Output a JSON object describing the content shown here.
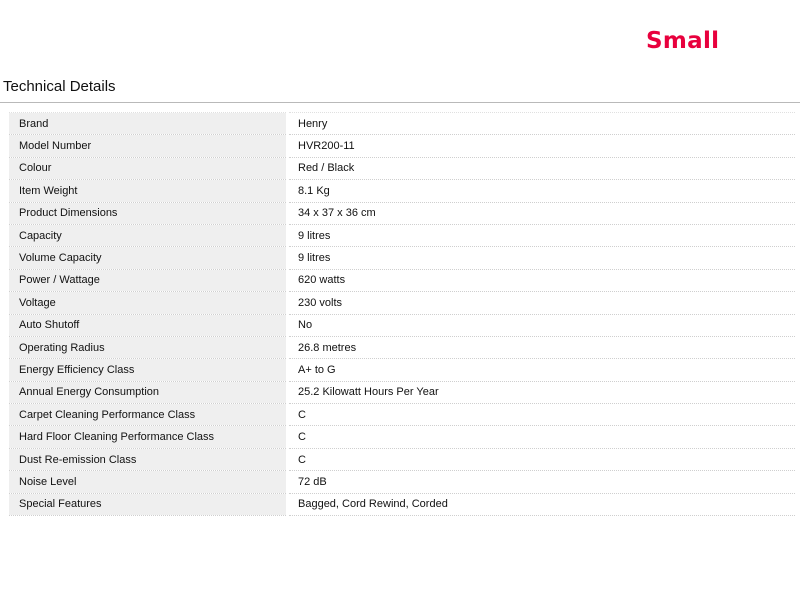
{
  "badge": "Small",
  "section_title": "Technical Details",
  "rows": [
    {
      "label": "Brand",
      "value": "Henry"
    },
    {
      "label": "Model Number",
      "value": "HVR200-11"
    },
    {
      "label": "Colour",
      "value": "Red / Black"
    },
    {
      "label": "Item Weight",
      "value": "8.1 Kg"
    },
    {
      "label": "Product Dimensions",
      "value": "34 x 37 x 36 cm"
    },
    {
      "label": "Capacity",
      "value": "9 litres"
    },
    {
      "label": "Volume Capacity",
      "value": "9 litres"
    },
    {
      "label": "Power / Wattage",
      "value": "620 watts"
    },
    {
      "label": "Voltage",
      "value": "230 volts"
    },
    {
      "label": "Auto Shutoff",
      "value": "No"
    },
    {
      "label": "Operating Radius",
      "value": "26.8 metres"
    },
    {
      "label": "Energy Efficiency Class",
      "value": "A+ to G"
    },
    {
      "label": "Annual Energy Consumption",
      "value": "25.2 Kilowatt Hours Per Year"
    },
    {
      "label": "Carpet Cleaning Performance Class",
      "value": "C"
    },
    {
      "label": "Hard Floor Cleaning Performance Class",
      "value": "C"
    },
    {
      "label": "Dust Re-emission Class",
      "value": "C"
    },
    {
      "label": "Noise Level",
      "value": "72 dB"
    },
    {
      "label": "Special Features",
      "value": "Bagged, Cord Rewind, Corded"
    }
  ],
  "colors": {
    "badge": "#e8003d",
    "label_background": "#efefef"
  }
}
